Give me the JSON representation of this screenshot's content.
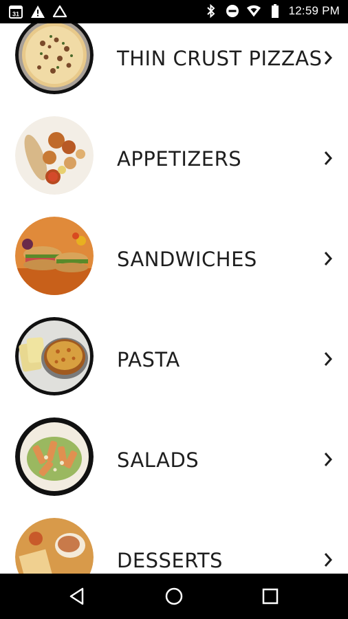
{
  "status_bar": {
    "time": "12:59 PM",
    "calendar_day": "31",
    "icons_left": [
      "calendar-icon",
      "warning-icon",
      "drive-icon"
    ],
    "icons_right": [
      "bluetooth-icon",
      "do-not-disturb-icon",
      "wifi-icon",
      "battery-icon"
    ]
  },
  "menu": {
    "items": [
      {
        "label": "THIN CRUST PIZZAS",
        "icon": "pizza-image"
      },
      {
        "label": "APPETIZERS",
        "icon": "appetizers-image"
      },
      {
        "label": "SANDWICHES",
        "icon": "sandwiches-image"
      },
      {
        "label": "PASTA",
        "icon": "pasta-image"
      },
      {
        "label": "SALADS",
        "icon": "salads-image"
      },
      {
        "label": "DESSERTS",
        "icon": "desserts-image"
      }
    ]
  },
  "nav_bar": {
    "buttons": [
      "back-icon",
      "home-icon",
      "recents-icon"
    ]
  },
  "colors": {
    "status_bar_bg": "#000000",
    "text": "#1e1e1e",
    "background": "#ffffff"
  }
}
